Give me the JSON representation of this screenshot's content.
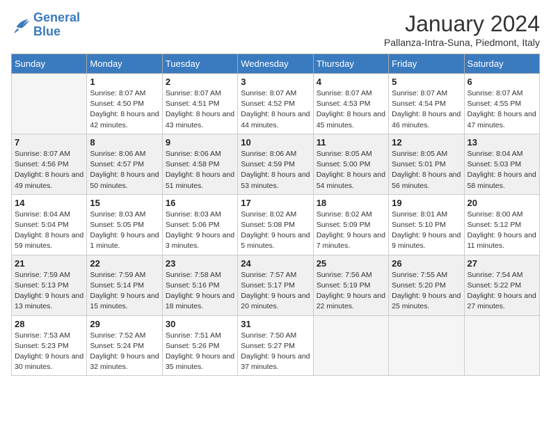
{
  "logo": {
    "name_part1": "General",
    "name_part2": "Blue"
  },
  "header": {
    "month": "January 2024",
    "location": "Pallanza-Intra-Suna, Piedmont, Italy"
  },
  "weekdays": [
    "Sunday",
    "Monday",
    "Tuesday",
    "Wednesday",
    "Thursday",
    "Friday",
    "Saturday"
  ],
  "weeks": [
    [
      {
        "day": "",
        "sunrise": "",
        "sunset": "",
        "daylight": "",
        "empty": true
      },
      {
        "day": "1",
        "sunrise": "Sunrise: 8:07 AM",
        "sunset": "Sunset: 4:50 PM",
        "daylight": "Daylight: 8 hours and 42 minutes."
      },
      {
        "day": "2",
        "sunrise": "Sunrise: 8:07 AM",
        "sunset": "Sunset: 4:51 PM",
        "daylight": "Daylight: 8 hours and 43 minutes."
      },
      {
        "day": "3",
        "sunrise": "Sunrise: 8:07 AM",
        "sunset": "Sunset: 4:52 PM",
        "daylight": "Daylight: 8 hours and 44 minutes."
      },
      {
        "day": "4",
        "sunrise": "Sunrise: 8:07 AM",
        "sunset": "Sunset: 4:53 PM",
        "daylight": "Daylight: 8 hours and 45 minutes."
      },
      {
        "day": "5",
        "sunrise": "Sunrise: 8:07 AM",
        "sunset": "Sunset: 4:54 PM",
        "daylight": "Daylight: 8 hours and 46 minutes."
      },
      {
        "day": "6",
        "sunrise": "Sunrise: 8:07 AM",
        "sunset": "Sunset: 4:55 PM",
        "daylight": "Daylight: 8 hours and 47 minutes."
      }
    ],
    [
      {
        "day": "7",
        "sunrise": "Sunrise: 8:07 AM",
        "sunset": "Sunset: 4:56 PM",
        "daylight": "Daylight: 8 hours and 49 minutes."
      },
      {
        "day": "8",
        "sunrise": "Sunrise: 8:06 AM",
        "sunset": "Sunset: 4:57 PM",
        "daylight": "Daylight: 8 hours and 50 minutes."
      },
      {
        "day": "9",
        "sunrise": "Sunrise: 8:06 AM",
        "sunset": "Sunset: 4:58 PM",
        "daylight": "Daylight: 8 hours and 51 minutes."
      },
      {
        "day": "10",
        "sunrise": "Sunrise: 8:06 AM",
        "sunset": "Sunset: 4:59 PM",
        "daylight": "Daylight: 8 hours and 53 minutes."
      },
      {
        "day": "11",
        "sunrise": "Sunrise: 8:05 AM",
        "sunset": "Sunset: 5:00 PM",
        "daylight": "Daylight: 8 hours and 54 minutes."
      },
      {
        "day": "12",
        "sunrise": "Sunrise: 8:05 AM",
        "sunset": "Sunset: 5:01 PM",
        "daylight": "Daylight: 8 hours and 56 minutes."
      },
      {
        "day": "13",
        "sunrise": "Sunrise: 8:04 AM",
        "sunset": "Sunset: 5:03 PM",
        "daylight": "Daylight: 8 hours and 58 minutes."
      }
    ],
    [
      {
        "day": "14",
        "sunrise": "Sunrise: 8:04 AM",
        "sunset": "Sunset: 5:04 PM",
        "daylight": "Daylight: 8 hours and 59 minutes."
      },
      {
        "day": "15",
        "sunrise": "Sunrise: 8:03 AM",
        "sunset": "Sunset: 5:05 PM",
        "daylight": "Daylight: 9 hours and 1 minute."
      },
      {
        "day": "16",
        "sunrise": "Sunrise: 8:03 AM",
        "sunset": "Sunset: 5:06 PM",
        "daylight": "Daylight: 9 hours and 3 minutes."
      },
      {
        "day": "17",
        "sunrise": "Sunrise: 8:02 AM",
        "sunset": "Sunset: 5:08 PM",
        "daylight": "Daylight: 9 hours and 5 minutes."
      },
      {
        "day": "18",
        "sunrise": "Sunrise: 8:02 AM",
        "sunset": "Sunset: 5:09 PM",
        "daylight": "Daylight: 9 hours and 7 minutes."
      },
      {
        "day": "19",
        "sunrise": "Sunrise: 8:01 AM",
        "sunset": "Sunset: 5:10 PM",
        "daylight": "Daylight: 9 hours and 9 minutes."
      },
      {
        "day": "20",
        "sunrise": "Sunrise: 8:00 AM",
        "sunset": "Sunset: 5:12 PM",
        "daylight": "Daylight: 9 hours and 11 minutes."
      }
    ],
    [
      {
        "day": "21",
        "sunrise": "Sunrise: 7:59 AM",
        "sunset": "Sunset: 5:13 PM",
        "daylight": "Daylight: 9 hours and 13 minutes."
      },
      {
        "day": "22",
        "sunrise": "Sunrise: 7:59 AM",
        "sunset": "Sunset: 5:14 PM",
        "daylight": "Daylight: 9 hours and 15 minutes."
      },
      {
        "day": "23",
        "sunrise": "Sunrise: 7:58 AM",
        "sunset": "Sunset: 5:16 PM",
        "daylight": "Daylight: 9 hours and 18 minutes."
      },
      {
        "day": "24",
        "sunrise": "Sunrise: 7:57 AM",
        "sunset": "Sunset: 5:17 PM",
        "daylight": "Daylight: 9 hours and 20 minutes."
      },
      {
        "day": "25",
        "sunrise": "Sunrise: 7:56 AM",
        "sunset": "Sunset: 5:19 PM",
        "daylight": "Daylight: 9 hours and 22 minutes."
      },
      {
        "day": "26",
        "sunrise": "Sunrise: 7:55 AM",
        "sunset": "Sunset: 5:20 PM",
        "daylight": "Daylight: 9 hours and 25 minutes."
      },
      {
        "day": "27",
        "sunrise": "Sunrise: 7:54 AM",
        "sunset": "Sunset: 5:22 PM",
        "daylight": "Daylight: 9 hours and 27 minutes."
      }
    ],
    [
      {
        "day": "28",
        "sunrise": "Sunrise: 7:53 AM",
        "sunset": "Sunset: 5:23 PM",
        "daylight": "Daylight: 9 hours and 30 minutes."
      },
      {
        "day": "29",
        "sunrise": "Sunrise: 7:52 AM",
        "sunset": "Sunset: 5:24 PM",
        "daylight": "Daylight: 9 hours and 32 minutes."
      },
      {
        "day": "30",
        "sunrise": "Sunrise: 7:51 AM",
        "sunset": "Sunset: 5:26 PM",
        "daylight": "Daylight: 9 hours and 35 minutes."
      },
      {
        "day": "31",
        "sunrise": "Sunrise: 7:50 AM",
        "sunset": "Sunset: 5:27 PM",
        "daylight": "Daylight: 9 hours and 37 minutes."
      },
      {
        "day": "",
        "sunrise": "",
        "sunset": "",
        "daylight": "",
        "empty": true
      },
      {
        "day": "",
        "sunrise": "",
        "sunset": "",
        "daylight": "",
        "empty": true
      },
      {
        "day": "",
        "sunrise": "",
        "sunset": "",
        "daylight": "",
        "empty": true
      }
    ]
  ]
}
